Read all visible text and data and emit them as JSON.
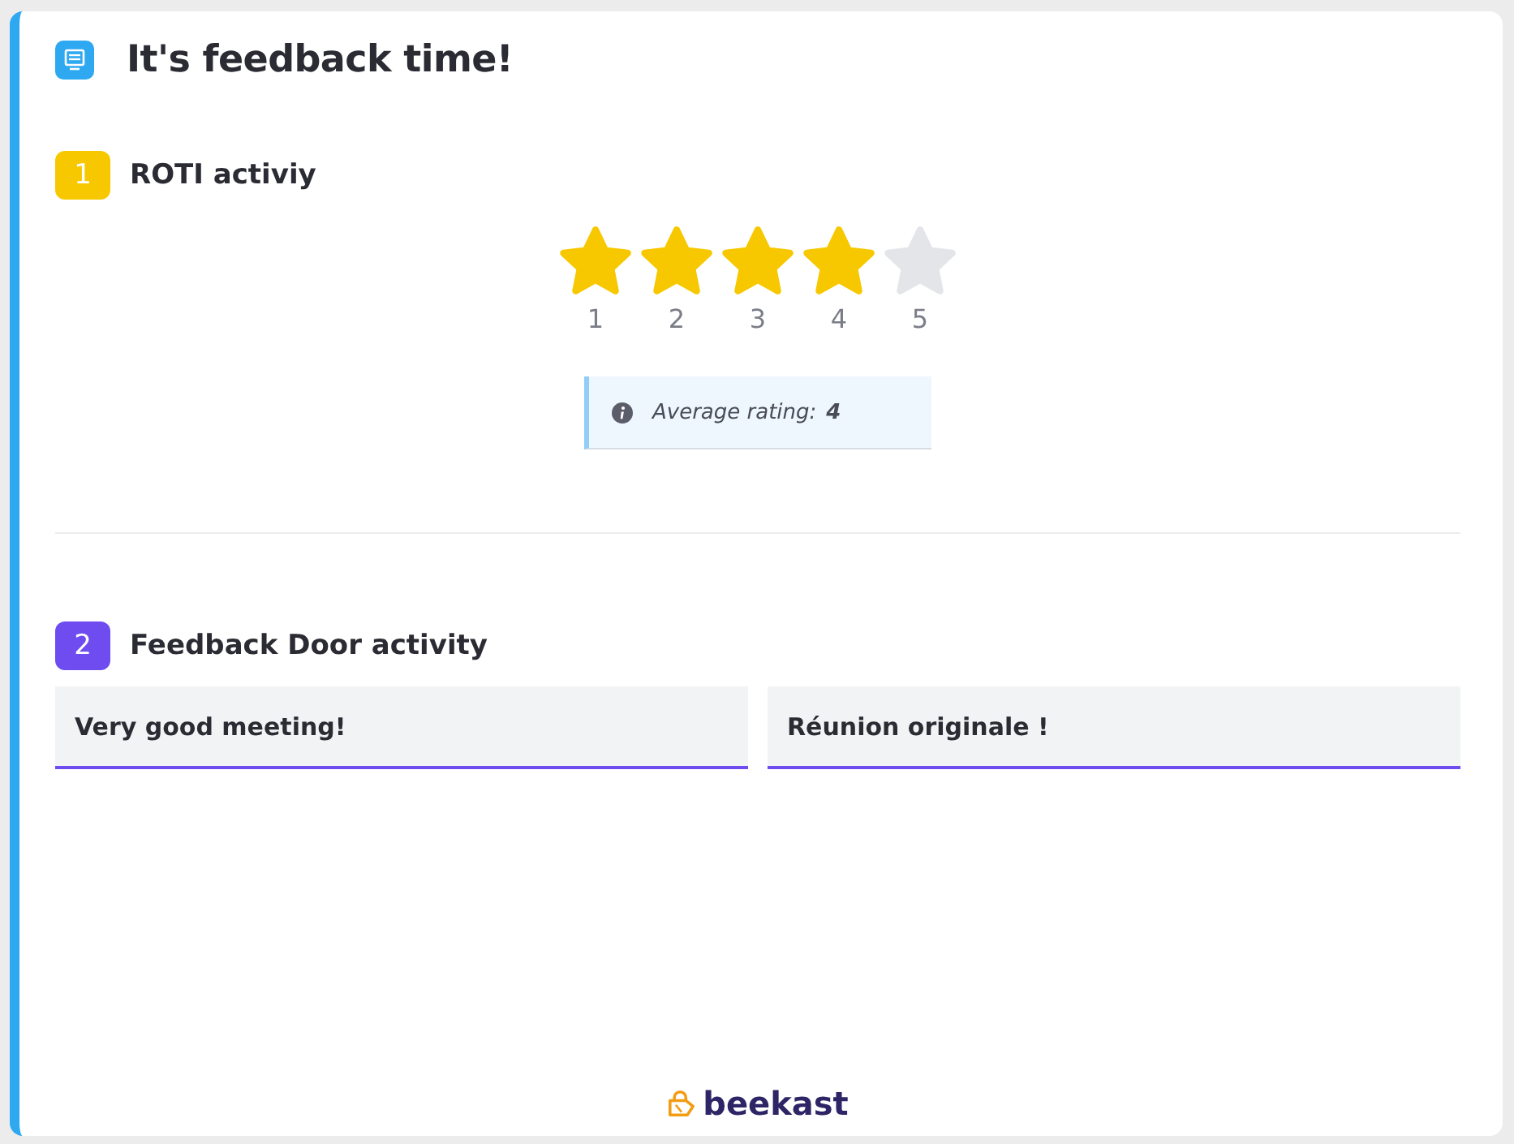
{
  "title": "It's feedback time!",
  "sections": [
    {
      "number": "1",
      "title": "ROTI activiy",
      "color": "#f7c800",
      "kind": "rating",
      "stars": 4,
      "star_labels": [
        "1",
        "2",
        "3",
        "4",
        "5"
      ],
      "average_label": "Average rating:",
      "average_value": "4"
    },
    {
      "number": "2",
      "title": "Feedback Door activity",
      "color": "#6e4cf0",
      "kind": "notes",
      "notes": [
        "Very good meeting!",
        "Réunion originale !"
      ]
    }
  ],
  "footer": {
    "brand": "beekast"
  }
}
